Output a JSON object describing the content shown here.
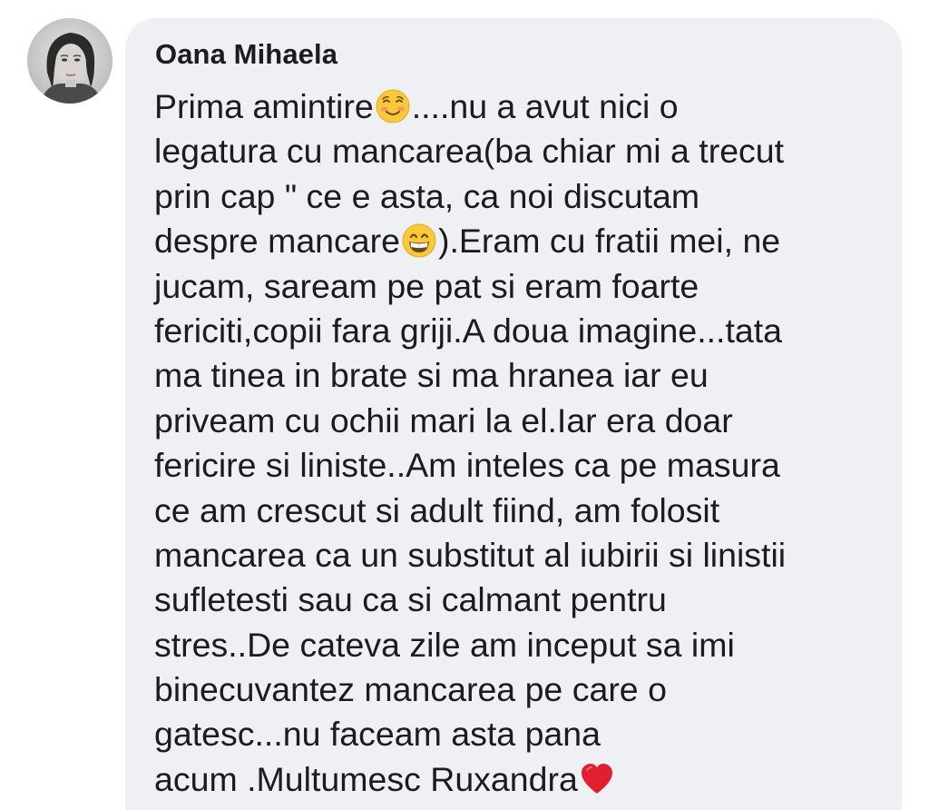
{
  "comment": {
    "author": "Oana Mihaela",
    "lines": [
      [
        "Prima amintire",
        "....nu a avut nici o"
      ],
      [
        "legatura cu mancarea(ba chiar mi a trecut"
      ],
      [
        "prin cap \" ce e asta, ca noi discutam"
      ],
      [
        "despre mancare",
        ").Eram cu fratii mei, ne"
      ],
      [
        "jucam, saream pe pat si eram foarte"
      ],
      [
        "fericiti,copii fara griji.A doua imagine...tata"
      ],
      [
        "ma tinea in brate si ma hranea iar eu"
      ],
      [
        "priveam cu ochii mari la el.Iar era doar"
      ],
      [
        "fericire si liniste..Am inteles ca pe masura"
      ],
      [
        "ce am crescut si adult fiind, am folosit"
      ],
      [
        "mancarea ca un substitut al iubirii si linistii"
      ],
      [
        "sufletesti sau ca si calmant pentru"
      ],
      [
        "stres..De cateva zile am inceput sa imi"
      ],
      [
        "binecuvantez mancarea pe care o"
      ],
      [
        "gatesc...nu faceam asta pana"
      ],
      [
        "acum .Multumesc Ruxandra"
      ]
    ],
    "emojis": {
      "line1": "smiling-face-emoji",
      "line4": "grinning-face-emoji",
      "line16": "red-heart-emoji"
    }
  },
  "colors": {
    "bubble": "#eff0f3",
    "text": "#1c1c1e",
    "emoji_yellow": "#f9c93a",
    "heart_red": "#e0202e"
  }
}
